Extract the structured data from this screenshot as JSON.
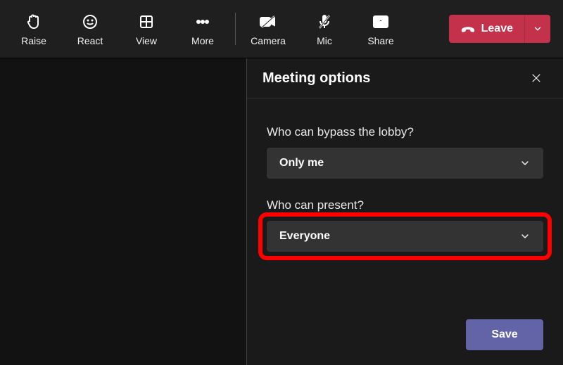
{
  "toolbar": {
    "raise": "Raise",
    "react": "React",
    "view": "View",
    "more": "More",
    "camera": "Camera",
    "mic": "Mic",
    "share": "Share",
    "leave": "Leave"
  },
  "panel": {
    "title": "Meeting options",
    "lobby_label": "Who can bypass the lobby?",
    "lobby_value": "Only me",
    "present_label": "Who can present?",
    "present_value": "Everyone",
    "save": "Save"
  }
}
